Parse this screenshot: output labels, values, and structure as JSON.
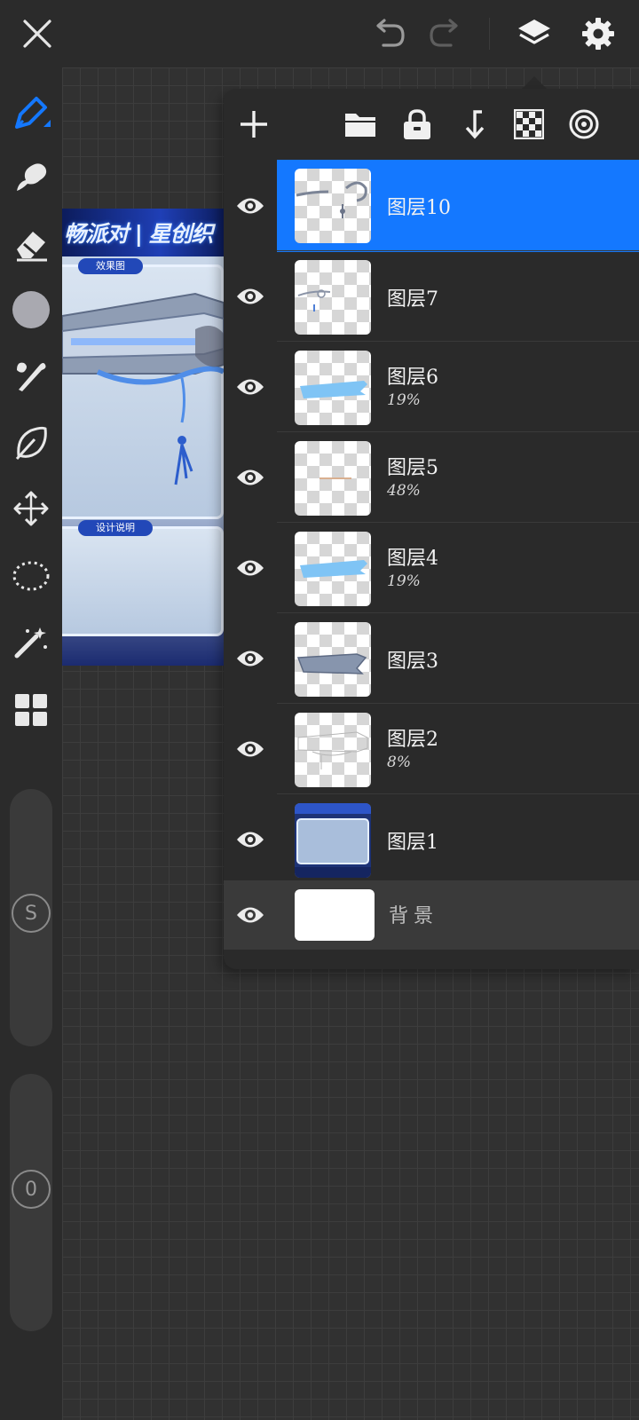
{
  "app": {
    "accent": "#1478ff",
    "background": "#2b2b2b"
  },
  "topbar": {
    "close": "close-icon",
    "undo": "undo-icon",
    "redo": "redo-icon",
    "layers": "layers-icon",
    "settings": "gear-icon"
  },
  "toolbar": {
    "tools": [
      "pen-tool",
      "smudge-tool",
      "eraser-tool",
      "color-picker",
      "brush-tool",
      "fill-tool",
      "move-tool",
      "lasso-tool",
      "magic-wand-tool",
      "gallery-tool"
    ],
    "brush_size_label": "S",
    "opacity_label": "0"
  },
  "artwork": {
    "banner_text": "畅派对 | 星创织",
    "tag_effect": "效果图",
    "tag_design": "设计说明"
  },
  "layer_panel": {
    "tools": [
      "add-icon",
      "folder-icon",
      "lock-icon",
      "merge-down-icon",
      "transparency-icon",
      "reference-icon"
    ],
    "layers": [
      {
        "name": "图层10",
        "opacity": "",
        "visible": true,
        "active": true
      },
      {
        "name": "图层7",
        "opacity": "",
        "visible": true,
        "active": false
      },
      {
        "name": "图层6",
        "opacity": "19%",
        "visible": true,
        "active": false
      },
      {
        "name": "图层5",
        "opacity": "48%",
        "visible": true,
        "active": false
      },
      {
        "name": "图层4",
        "opacity": "19%",
        "visible": true,
        "active": false
      },
      {
        "name": "图层3",
        "opacity": "",
        "visible": true,
        "active": false
      },
      {
        "name": "图层2",
        "opacity": "8%",
        "visible": true,
        "active": false
      },
      {
        "name": "图层1",
        "opacity": "",
        "visible": true,
        "active": false
      }
    ],
    "background_layer": {
      "name": "背景",
      "visible": true
    }
  }
}
